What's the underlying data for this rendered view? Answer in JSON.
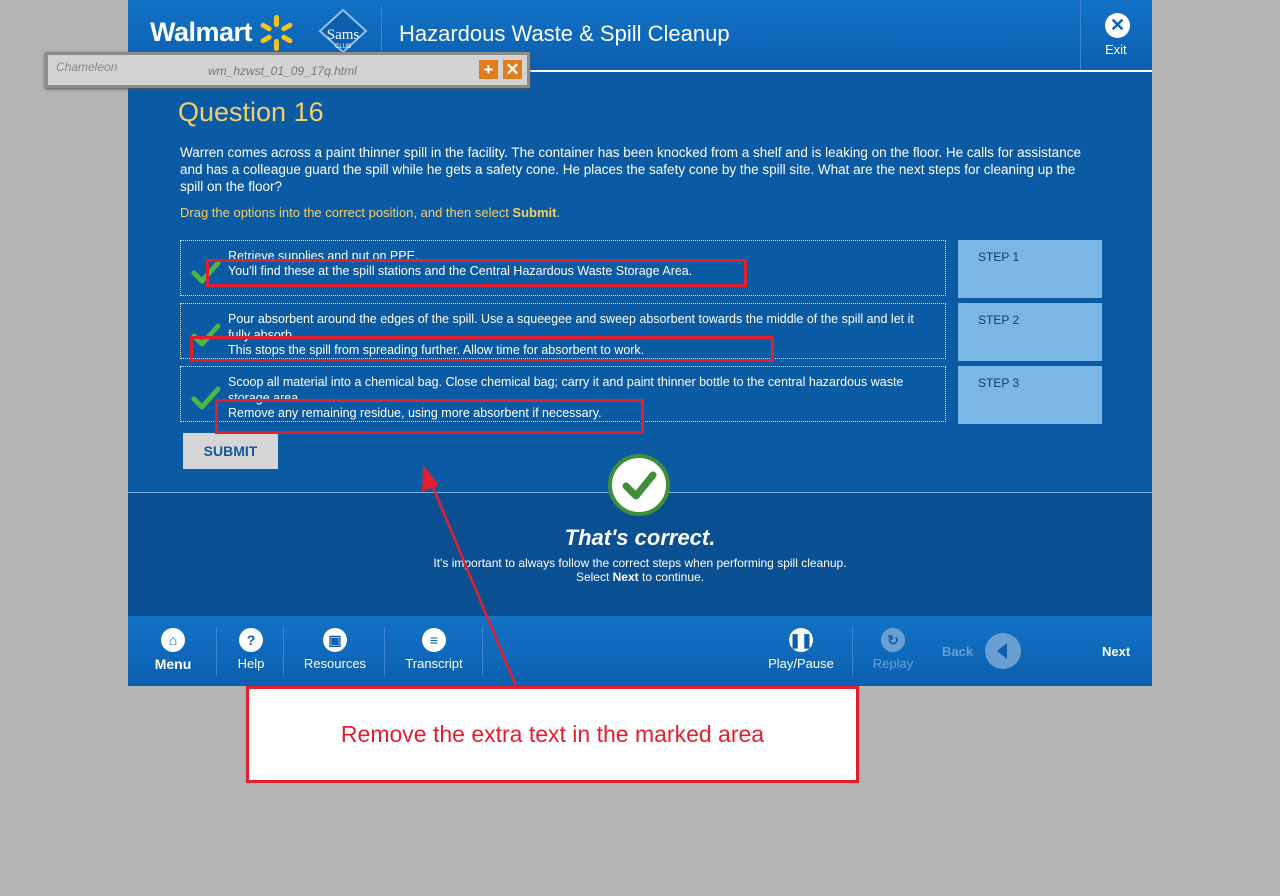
{
  "header": {
    "brand": "Walmart",
    "sams_logo": "Sams",
    "sams_sub": "CLUB",
    "course_title": "Hazardous Waste & Spill Cleanup",
    "exit_label": "Exit"
  },
  "question": {
    "title": "Question 16",
    "text": "Warren comes across a paint thinner spill in the facility.  The container has been knocked from a shelf and is leaking on the floor.  He calls for assistance and has a colleague guard the spill while he gets a safety cone.  He places the safety cone by the spill site.  What are the next steps for cleaning up the spill on the floor?",
    "instruction_prefix": "Drag the options into the correct position, and then select ",
    "instruction_bold": "Submit",
    "instruction_suffix": "."
  },
  "answers": [
    {
      "line1": "Retrieve supplies and put on PPE.",
      "line2": "You'll find these at the spill stations and the Central Hazardous Waste Storage Area.",
      "step": "STEP 1"
    },
    {
      "line1": "Pour absorbent around the edges of the spill.  Use a squeegee and sweep absorbent towards the middle of the spill and let it fully absorb.",
      "line2": "This stops the spill from spreading further.  Allow time for absorbent to work.",
      "step": "STEP 2"
    },
    {
      "line1": "Scoop all material into a chemical bag.  Close chemical bag; carry it and paint thinner bottle to the central hazardous waste storage area.",
      "line2": "Remove any remaining residue, using more absorbent if necessary.",
      "step": "STEP 3"
    }
  ],
  "submit_label": "SUBMIT",
  "feedback": {
    "title": "That's correct.",
    "line1": "It's important to always follow the correct steps when performing spill cleanup.",
    "line2_prefix": "Select ",
    "line2_bold": "Next",
    "line2_suffix": " to continue."
  },
  "nav": {
    "menu": "Menu",
    "help": "Help",
    "resources": "Resources",
    "transcript": "Transcript",
    "playpause": "Play/Pause",
    "replay": "Replay",
    "back": "Back",
    "next": "Next"
  },
  "annotation": {
    "callout": "Remove the extra text in the marked area"
  },
  "recorder": {
    "logo": "Chameleon",
    "filename": "wm_hzwst_01_09_17q.html"
  },
  "colors": {
    "primary_blue": "#0a5aa4",
    "accent_gold": "#f1cf6e",
    "step_box": "#7ab7e6",
    "annotation_red": "#e02030",
    "correct_green": "#3f8f3a"
  }
}
